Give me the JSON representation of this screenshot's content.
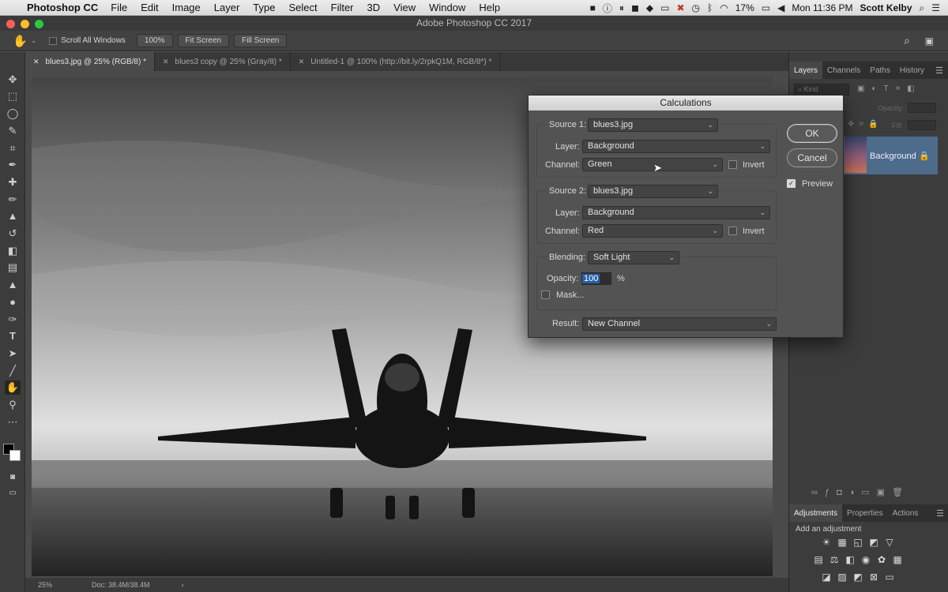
{
  "menubar": {
    "app_name": "Photoshop CC",
    "items": [
      "File",
      "Edit",
      "Image",
      "Layer",
      "Type",
      "Select",
      "Filter",
      "3D",
      "View",
      "Window",
      "Help"
    ],
    "battery": "17%",
    "clock": "Mon 11:36 PM",
    "user": "Scott Kelby"
  },
  "window": {
    "title": "Adobe Photoshop CC 2017"
  },
  "options": {
    "scroll_all_label": "Scroll All Windows",
    "zoom_btn": "100%",
    "fit_btn": "Fit Screen",
    "fill_btn": "Fill Screen"
  },
  "tabs": [
    {
      "label": "blues3.jpg @ 25% (RGB/8) *"
    },
    {
      "label": "blues3 copy @ 25% (Gray/8) *"
    },
    {
      "label": "Untitled-1 @ 100% (http://bit.ly/2rpkQ1M, RGB/8*) *"
    }
  ],
  "status": {
    "zoom": "25%",
    "doc": "Doc: 38.4M/38.4M"
  },
  "layers_panel": {
    "tabs": [
      "Layers",
      "Channels",
      "Paths",
      "History"
    ],
    "kind_placeholder": "Kind",
    "opacity_label": "Opacity:",
    "fill_label": "Fill:",
    "layer_name": "Background"
  },
  "adjust_panel": {
    "tabs": [
      "Adjustments",
      "Properties",
      "Actions"
    ],
    "heading": "Add an adjustment"
  },
  "dialog": {
    "title": "Calculations",
    "source1_label": "Source 1:",
    "source1_value": "blues3.jpg",
    "layer1_label": "Layer:",
    "layer1_value": "Background",
    "channel1_label": "Channel:",
    "channel1_value": "Green",
    "invert1_label": "Invert",
    "source2_label": "Source 2:",
    "source2_value": "blues3.jpg",
    "layer2_label": "Layer:",
    "layer2_value": "Background",
    "channel2_label": "Channel:",
    "channel2_value": "Red",
    "invert2_label": "Invert",
    "blending_label": "Blending:",
    "blending_value": "Soft Light",
    "opacity_label": "Opacity:",
    "opacity_value": "100",
    "percent": "%",
    "mask_label": "Mask...",
    "result_label": "Result:",
    "result_value": "New Channel",
    "ok": "OK",
    "cancel": "Cancel",
    "preview_label": "Preview"
  }
}
